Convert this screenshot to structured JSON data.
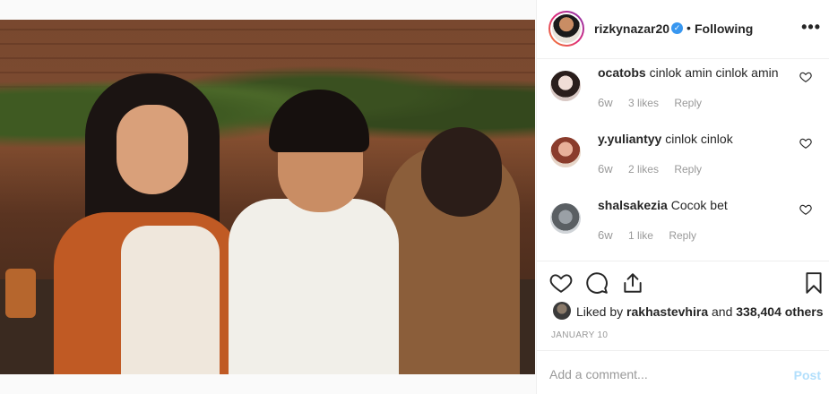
{
  "post": {
    "username": "rizkynazar20",
    "separator": "•",
    "follow_status": "Following",
    "more_label": "•••",
    "verified_glyph": "✓"
  },
  "comments": [
    {
      "user": "ocatobs",
      "text": "cinlok amin cinlok amin",
      "time": "6w",
      "likes": "3 likes",
      "reply": "Reply"
    },
    {
      "user": "y.yuliantyy",
      "text": "cinlok cinlok",
      "time": "6w",
      "likes": "2 likes",
      "reply": "Reply"
    },
    {
      "user": "shalsakezia",
      "text": "Cocok bet",
      "time": "6w",
      "likes": "1 like",
      "reply": "Reply"
    }
  ],
  "likes": {
    "prefix": "Liked by ",
    "user": "rakhastevhira",
    "middle": " and ",
    "count": "338,404 others"
  },
  "date": "JANUARY 10",
  "add_comment": {
    "placeholder": "Add a comment...",
    "post_label": "Post"
  },
  "colors": {
    "accent_blue": "#3897f0",
    "post_disabled": "#b2dffc",
    "border": "#efefef",
    "muted_text": "#999999"
  },
  "icons": [
    "heart-icon",
    "comment-icon",
    "share-icon",
    "bookmark-icon",
    "more-options-icon",
    "verified-badge-icon"
  ]
}
